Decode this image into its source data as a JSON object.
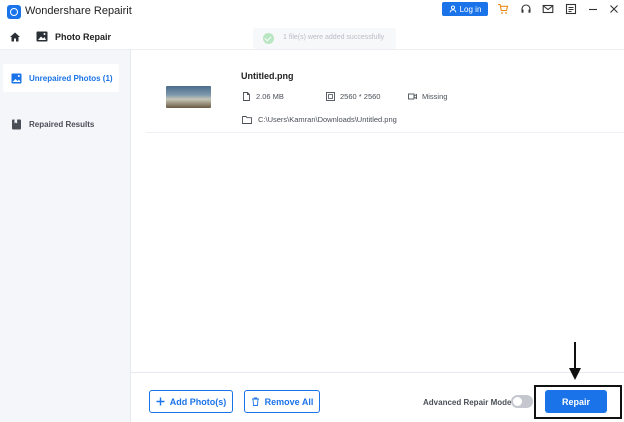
{
  "app": {
    "title": "Wondershare Repairit",
    "login_label": "Log in"
  },
  "header": {
    "title": "Photo Repair",
    "toast": "1 file(s) were added successfully"
  },
  "sidebar": {
    "items": [
      {
        "label": "Unrepaired Photos (1)",
        "icon": "image-icon",
        "active": true
      },
      {
        "label": "Repaired Results",
        "icon": "bookmark-icon",
        "active": false
      }
    ]
  },
  "file": {
    "name": "Untitled.png",
    "size": "2.06  MB",
    "resolution": "2560 * 2560",
    "camera": "Missing",
    "path": "C:\\Users\\Kamran\\Downloads\\Untitled.png"
  },
  "footer": {
    "add_label": "Add Photo(s)",
    "remove_label": "Remove All",
    "advanced_label": "Advanced Repair Mode",
    "advanced_on": false,
    "repair_label": "Repair"
  },
  "colors": {
    "accent": "#1a73e8",
    "sidebar_bg": "#f4f6fa"
  }
}
